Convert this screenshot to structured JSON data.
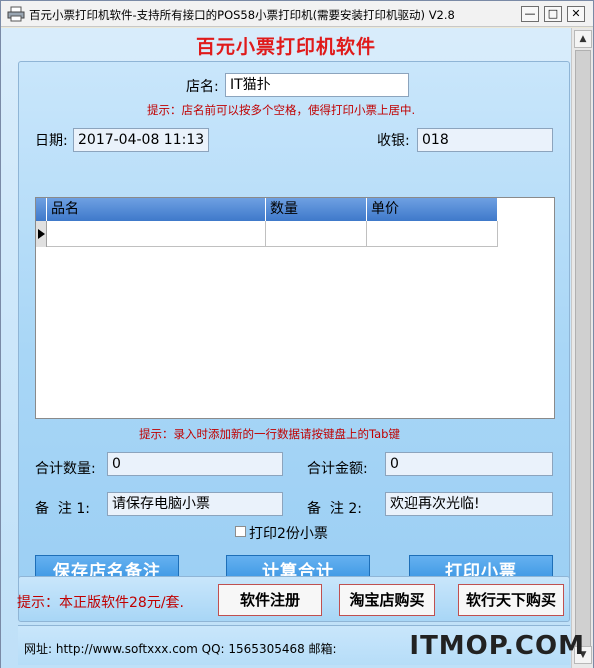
{
  "window": {
    "title": "百元小票打印机软件-支持所有接口的POS58小票打印机(需要安装打印机驱动)  V2.8",
    "minimize": "—",
    "maximize": "□",
    "close": "✕"
  },
  "app": {
    "heading": "百元小票打印机软件"
  },
  "form": {
    "store_name_label": "店名:",
    "store_name_value": "IT猫扑",
    "store_hint": "提示：店名前可以按多个空格，使得打印小票上居中.",
    "date_label": "日期:",
    "date_value": "2017-04-08 11:13",
    "cashier_label": "收银:",
    "cashier_value": "018"
  },
  "grid": {
    "columns": [
      "品名",
      "数量",
      "单价"
    ],
    "rows": [
      [
        "",
        "",
        ""
      ]
    ]
  },
  "entry_hint": "提示：录入时添加新的一行数据请按键盘上的Tab键",
  "totals": {
    "qty_label": "合计数量:",
    "qty_value": "0",
    "amount_label": "合计金额:",
    "amount_value": "0"
  },
  "notes": {
    "note1_label": "备  注 1:",
    "note1_value": "请保存电脑小票",
    "note2_label": "备  注 2:",
    "note2_value": "欢迎再次光临!"
  },
  "print_two_copies": {
    "label": "打印2份小票",
    "checked": false
  },
  "buttons": {
    "save": "保存店名备注",
    "calc": "计算合计",
    "print": "打印小票"
  },
  "bottom": {
    "notice": "提示：本正版软件28元/套.",
    "register": "软件注册",
    "taobao": "淘宝店购买",
    "ruanxing": "软行天下购买"
  },
  "footer": {
    "text": "网址: http://www.softxxx.com  QQ: 1565305468   邮箱: "
  },
  "watermark": {
    "text": "ITMOP.COM"
  },
  "colors": {
    "heading_red": "#e01a1a",
    "hint_red": "#c00000",
    "button_blue": "#2f8fe0",
    "grid_header_blue": "#3f79ca"
  }
}
